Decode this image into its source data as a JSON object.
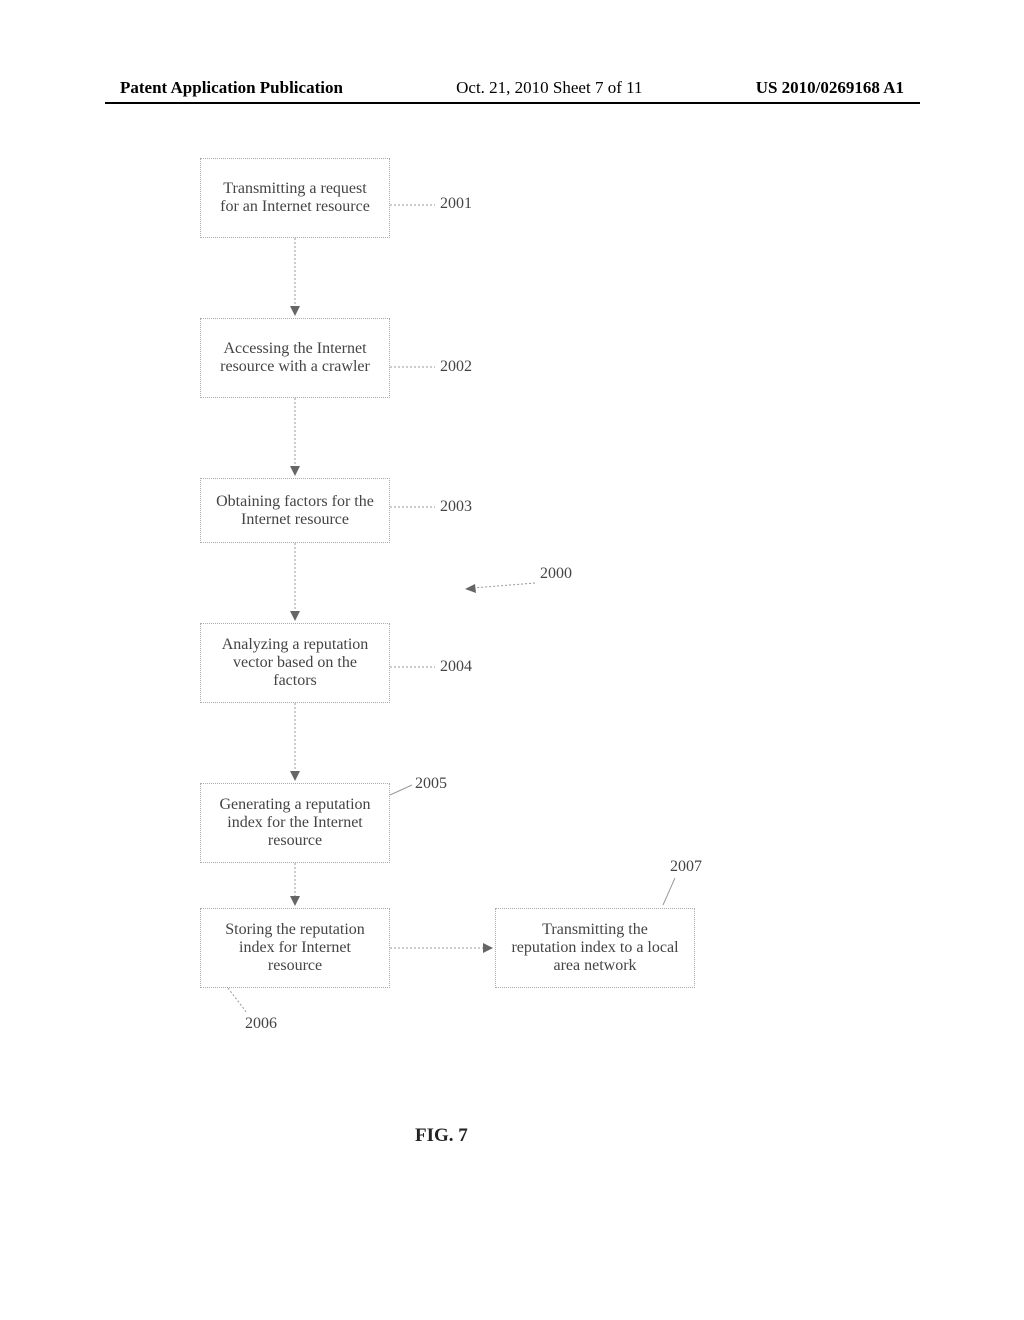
{
  "header": {
    "left": "Patent Application Publication",
    "center": "Oct. 21, 2010  Sheet 7 of 11",
    "right": "US 2010/0269168 A1"
  },
  "boxes": {
    "b1": "Transmitting a request for an Internet resource",
    "b2": "Accessing the Internet resource with a crawler",
    "b3": "Obtaining factors for the Internet resource",
    "b4": "Analyzing a reputation vector based on the factors",
    "b5": "Generating a reputation index for the Internet resource",
    "b6": "Storing the reputation index for Internet resource",
    "b7": "Transmitting the reputation index to a local area network"
  },
  "refs": {
    "r1": "2001",
    "r2": "2002",
    "r3": "2003",
    "r4": "2004",
    "r5": "2005",
    "r6": "2006",
    "r7": "2007",
    "r0": "2000"
  },
  "figure": "FIG. 7",
  "chart_data": {
    "type": "flowchart",
    "title": "FIG. 7",
    "nodes": [
      {
        "id": "2001",
        "label": "Transmitting a request for an Internet resource"
      },
      {
        "id": "2002",
        "label": "Accessing the Internet resource with a crawler"
      },
      {
        "id": "2003",
        "label": "Obtaining factors for the Internet resource"
      },
      {
        "id": "2004",
        "label": "Analyzing a reputation vector based on the factors"
      },
      {
        "id": "2005",
        "label": "Generating a reputation index for the Internet resource"
      },
      {
        "id": "2006",
        "label": "Storing the reputation index for Internet resource"
      },
      {
        "id": "2007",
        "label": "Transmitting the reputation index to a local area network"
      }
    ],
    "edges": [
      {
        "from": "2001",
        "to": "2002"
      },
      {
        "from": "2002",
        "to": "2003"
      },
      {
        "from": "2003",
        "to": "2004"
      },
      {
        "from": "2004",
        "to": "2005"
      },
      {
        "from": "2005",
        "to": "2006"
      },
      {
        "from": "2006",
        "to": "2007"
      }
    ],
    "overall_ref": "2000"
  }
}
